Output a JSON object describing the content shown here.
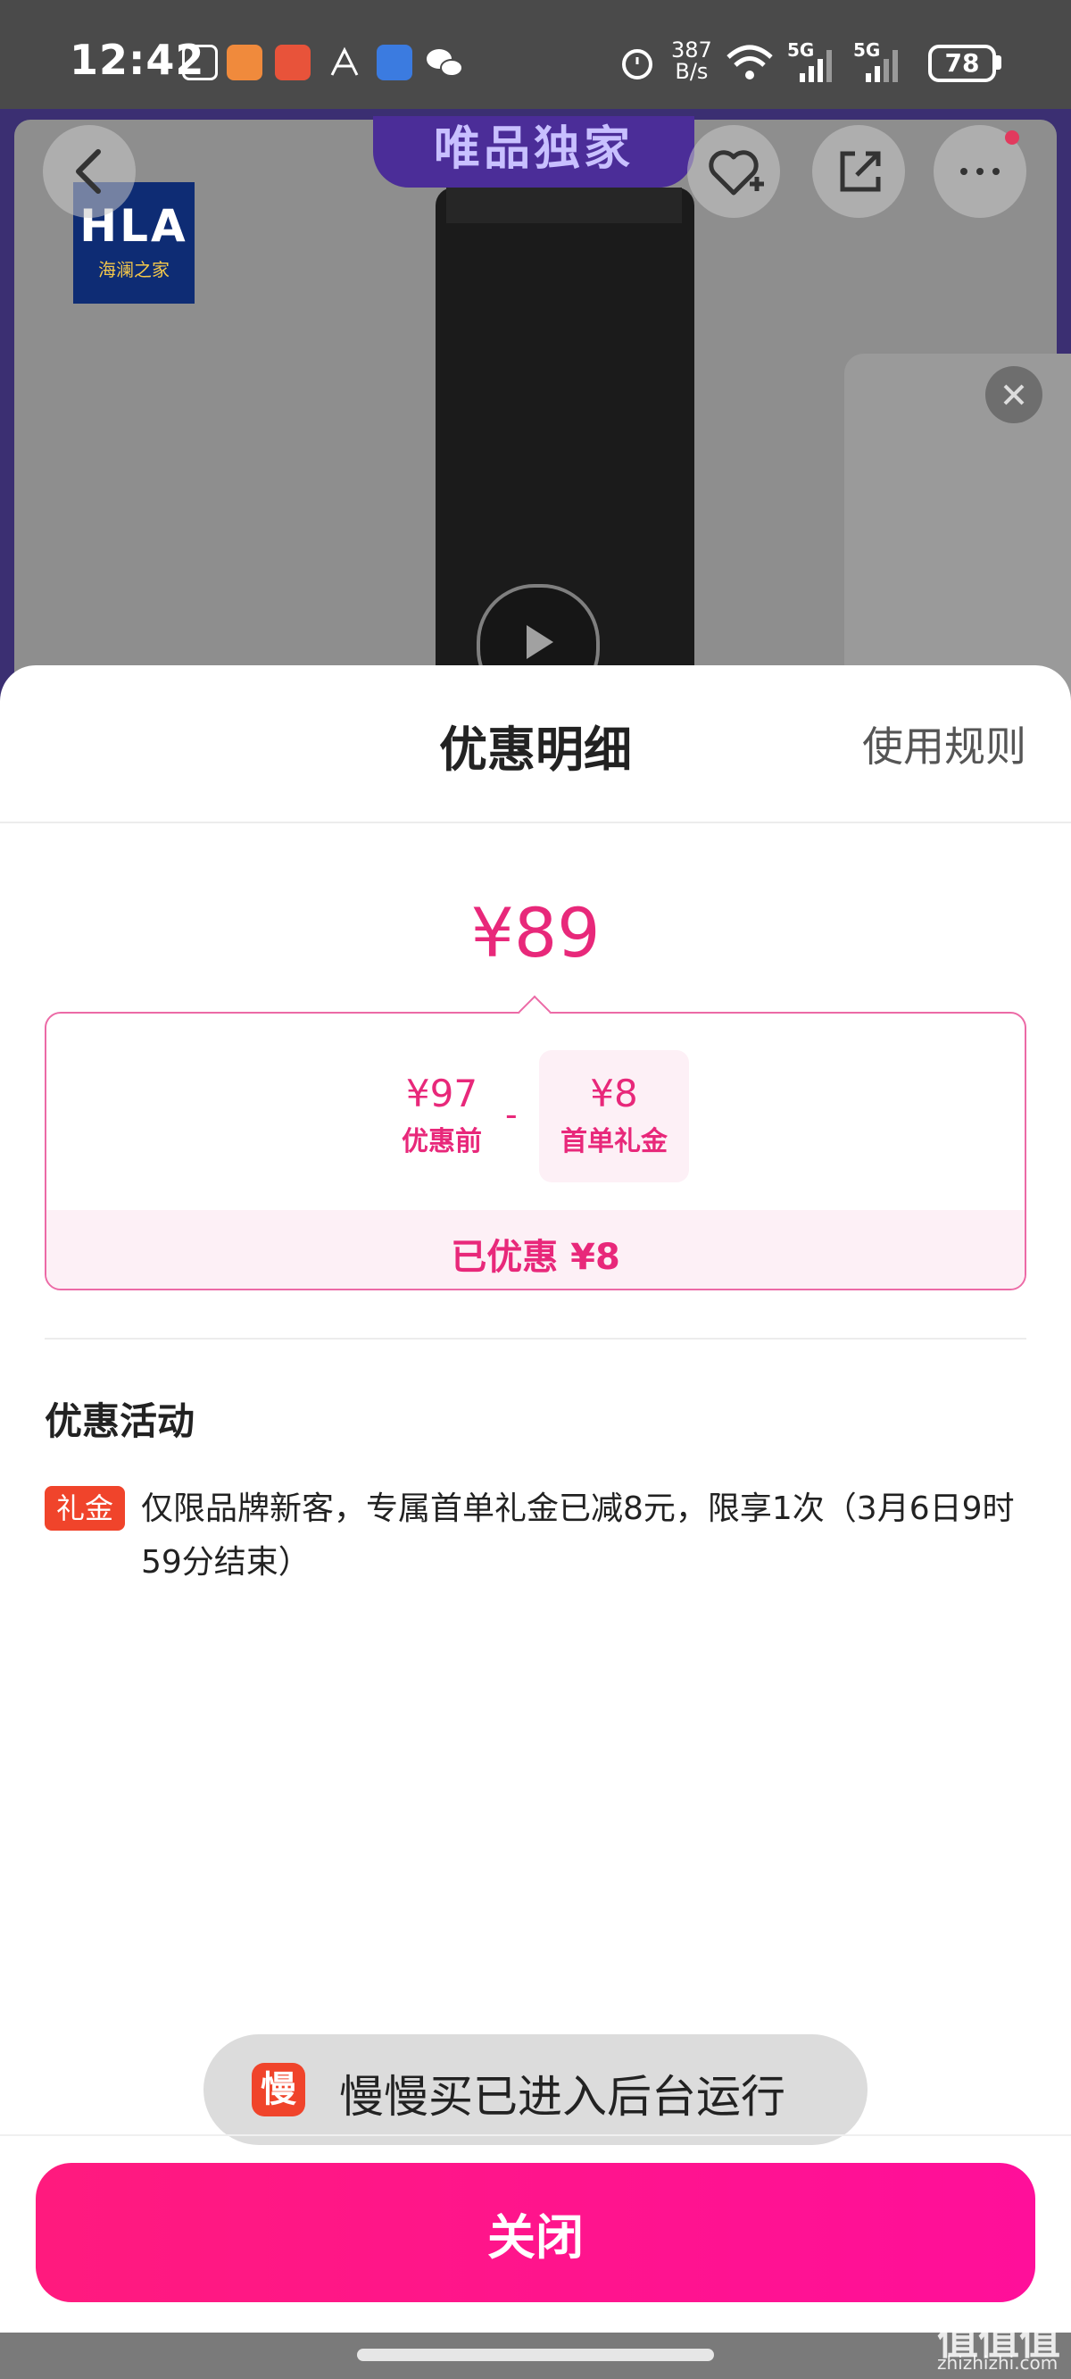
{
  "status_bar": {
    "time": "12:42",
    "net_speed_value": "387",
    "net_speed_unit": "B/s",
    "signal_1": "5G",
    "signal_2": "5G",
    "battery": "78"
  },
  "product_page": {
    "exclusive_banner": "唯品独家",
    "brand_logo_text": "HLA",
    "brand_logo_subtext": "海澜之家"
  },
  "sheet": {
    "title": "优惠明细",
    "rules_link": "使用规则",
    "final_price": "¥89",
    "breakdown": {
      "original_price": "¥97",
      "original_label": "优惠前",
      "operator": "-",
      "gift_amount": "¥8",
      "gift_label": "首单礼金",
      "saved_text": "已优惠 ¥8"
    },
    "activities_title": "优惠活动",
    "activities": [
      {
        "tag": "礼金",
        "text": "仅限品牌新客，专属首单礼金已减8元，限享1次（3月6日9时59分结束）"
      }
    ],
    "close_button": "关闭"
  },
  "toast": {
    "icon_char": "慢",
    "text": "慢慢买已进入后台运行"
  },
  "watermark": {
    "main": "值值值",
    "sub": "zhizhizhi.com"
  },
  "colors": {
    "accent": "#e8287a",
    "button": "#ff1a7e",
    "tag": "#f0442b"
  }
}
